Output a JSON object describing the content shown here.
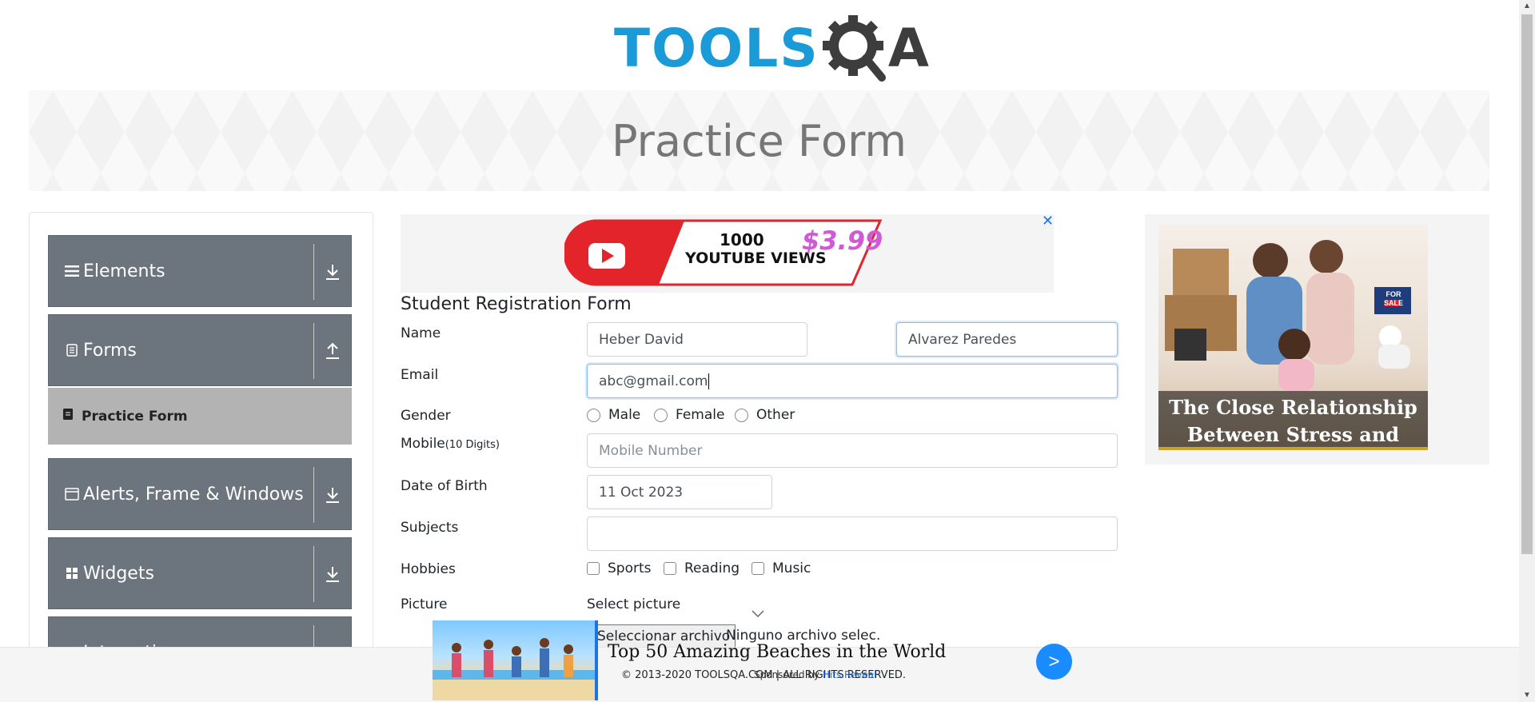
{
  "header": {
    "logo_text": "TOOLS",
    "logo_a": "A"
  },
  "banner": {
    "title": "Practice Form"
  },
  "sidebar": {
    "groups": [
      {
        "label": "Elements",
        "icon": "list-icon",
        "arrow": "download-arrow-icon"
      },
      {
        "label": "Forms",
        "icon": "document-icon",
        "arrow": "upload-arrow-icon"
      },
      {
        "label": "Alerts, Frame & Windows",
        "icon": "window-icon",
        "arrow": "download-arrow-icon"
      },
      {
        "label": "Widgets",
        "icon": "widgets-icon",
        "arrow": "download-arrow-icon"
      },
      {
        "label": "Interactions",
        "icon": "interactions-icon",
        "arrow": "download-arrow-icon"
      }
    ],
    "subitem": {
      "label": "Practice Form",
      "icon": "form-icon"
    }
  },
  "ad_top": {
    "line1": "1000",
    "line2": "YOUTUBE VIEWS",
    "price": "$3.99",
    "close": "✕"
  },
  "form": {
    "title": "Student Registration Form",
    "name_label": "Name",
    "first_name": "Heber David",
    "last_name": "Alvarez Paredes",
    "email_label": "Email",
    "email": "abc@gmail.com",
    "gender_label": "Gender",
    "genders": [
      "Male",
      "Female",
      "Other"
    ],
    "mobile_label": "Mobile",
    "mobile_note": "(10 Digits)",
    "mobile_placeholder": "Mobile Number",
    "dob_label": "Date of Birth",
    "dob": "11 Oct 2023",
    "subjects_label": "Subjects",
    "hobbies_label": "Hobbies",
    "hobbies": [
      "Sports",
      "Reading",
      "Music"
    ],
    "picture_label": "Picture",
    "picture_select": "Select picture",
    "file_button": "Seleccionar archivo",
    "file_status": "Ninguno archivo selec."
  },
  "ad_right": {
    "caption_line1": "The Close Relationship",
    "caption_line2": "Between Stress and Sleep",
    "sign": "FOR SALE"
  },
  "bottom": {
    "ad_title": "Top 50 Amazing Beaches in the World",
    "footer": "© 2013-2020 TOOLSQA.COM | ALL RIGHTS RESERVED.",
    "sponsored_prefix": "Sponsored by",
    "sponsored_by": "Hits.Reveal",
    "go": ">"
  },
  "colors": {
    "brand": "#1a9ad6",
    "sidebar_group": "#6c757d",
    "sidebar_active": "#b3b3b3",
    "accent_blue": "#1a8cff"
  }
}
